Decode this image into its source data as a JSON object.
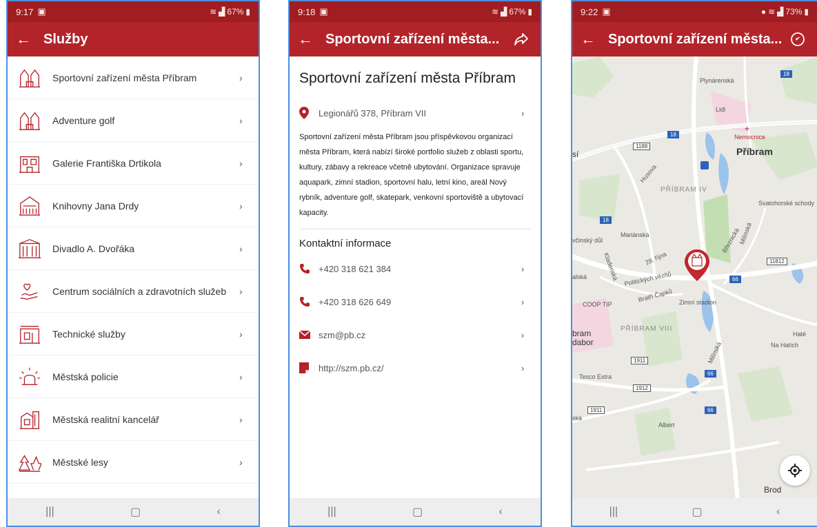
{
  "screen1": {
    "status": {
      "time": "9:17",
      "battery": "67%"
    },
    "title": "Služby",
    "items": [
      {
        "label": "Sportovní zařízení města Příbram",
        "icon": "castle-icon"
      },
      {
        "label": "Adventure golf",
        "icon": "castle-icon"
      },
      {
        "label": "Galerie Františka Drtikola",
        "icon": "gallery-building-icon"
      },
      {
        "label": "Knihovny Jana Drdy",
        "icon": "library-icon"
      },
      {
        "label": "Divadlo A. Dvořáka",
        "icon": "theatre-icon"
      },
      {
        "label": "Centrum sociálních a zdravotních služeb",
        "icon": "care-hands-icon"
      },
      {
        "label": "Technické služby",
        "icon": "technical-building-icon"
      },
      {
        "label": "Městská policie",
        "icon": "police-siren-icon"
      },
      {
        "label": "Městská realitní kancelář",
        "icon": "real-estate-icon"
      },
      {
        "label": "Městské lesy",
        "icon": "forest-icon"
      }
    ]
  },
  "screen2": {
    "status": {
      "time": "9:18",
      "battery": "67%"
    },
    "title": "Sportovní zařízení města...",
    "heading": "Sportovní zařízení města Příbram",
    "address": "Legionářů 378, Příbram VII",
    "description": "Sportovní zařízení města Příbram jsou příspěvkovou organizací města Příbram, která nabízí široké portfolio služeb z oblasti sportu, kultury, zábavy a rekreace včetně ubytování. Organizace spravuje aquapark, zimní stadion, sportovní halu, letní kino, areál Nový rybník, adventure golf, skatepark, venkovní sportoviště a ubytovací kapacity.",
    "contact_title": "Kontaktní informace",
    "contacts": [
      {
        "type": "phone",
        "value": "+420 318 621 384"
      },
      {
        "type": "phone",
        "value": "+420 318 626 649"
      },
      {
        "type": "email",
        "value": "szm@pb.cz"
      },
      {
        "type": "web",
        "value": "http://szm.pb.cz/"
      }
    ]
  },
  "screen3": {
    "status": {
      "time": "9:22",
      "battery": "73%"
    },
    "title": "Sportovní zařízení města...",
    "map_labels": {
      "plynarenska": "Plynárenská",
      "lidl": "Lidl",
      "nemocnice": "Nemocnice",
      "pribram": "Příbram",
      "husova": "Husova",
      "pribram_iv": "PŘÍBRAM IV",
      "svatohorske": "Svatohorské schody",
      "mariánska": "Mariánská",
      "vcinsky_dul": "včinský důl",
      "brezhnicka": "Březnická",
      "milinska": "Milínská",
      "kladenska": "Kladenská",
      "rijna": "28. října",
      "politickych": "Politických vězňů",
      "bratri_capku": "Bratří Čapků",
      "zimni_stadion": "Zimní stadion",
      "coop": "COOP TIP",
      "pribram_viii": "PŘÍBRAM VIII",
      "bram": "bram",
      "dabor": "dabor",
      "hate": "Haté",
      "na_hatich": "Na Hatích",
      "tesco": "Tesco Extra",
      "milinska2": "Milínská",
      "albert": "Albert",
      "brod": "Brod",
      "si": "sí",
      "ska": "ská",
      "alska": "alská"
    },
    "road_numbers": {
      "r18a": "18",
      "r18b": "18",
      "r18c": "18",
      "r1188": "1188",
      "r11812": "11812",
      "r66a": "66",
      "r66b": "66",
      "r66c": "66",
      "r1911a": "1911",
      "r1911b": "1911",
      "r1912": "1912"
    }
  },
  "colors": {
    "primary": "#b3232a",
    "status_bar": "#a01d22"
  }
}
